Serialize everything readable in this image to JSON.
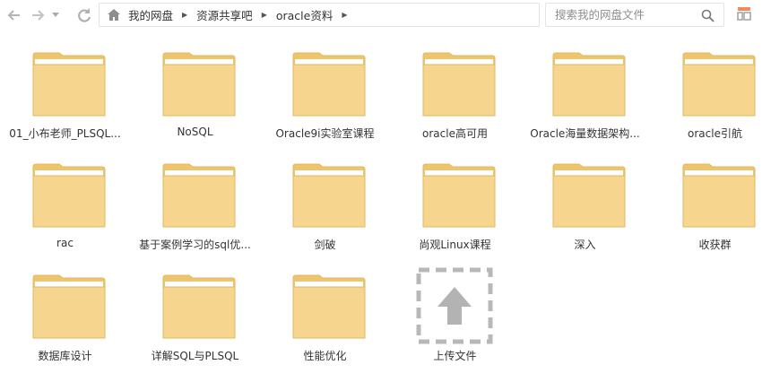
{
  "toolbar": {
    "back_icon": "back-arrow-icon",
    "forward_icon": "forward-arrow-icon",
    "dropdown_icon": "chevron-down-icon",
    "refresh_icon": "refresh-icon"
  },
  "breadcrumb": {
    "items": [
      "我的网盘",
      "资源共享吧",
      "oracle资料"
    ]
  },
  "search": {
    "placeholder": "搜索我的网盘文件"
  },
  "colors": {
    "folder_body": "#f6d58f",
    "folder_tab": "#eec56e",
    "folder_edge": "#e2b85e",
    "upload_dash": "#b8b8b8",
    "upload_arrow": "#b3b3b3"
  },
  "items": [
    {
      "label": "01_小布老师_PLSQL..."
    },
    {
      "label": "NoSQL"
    },
    {
      "label": "Oracle9i实验室课程"
    },
    {
      "label": "oracle高可用"
    },
    {
      "label": "Oracle海量数据架构..."
    },
    {
      "label": "oracle引航"
    },
    {
      "label": "rac"
    },
    {
      "label": "基于案例学习的sql优..."
    },
    {
      "label": "剑破"
    },
    {
      "label": "尚观Linux课程"
    },
    {
      "label": "深入"
    },
    {
      "label": "收获群"
    },
    {
      "label": "数据库设计"
    },
    {
      "label": "详解SQL与PLSQL"
    },
    {
      "label": "性能优化"
    }
  ],
  "upload": {
    "label": "上传文件"
  }
}
